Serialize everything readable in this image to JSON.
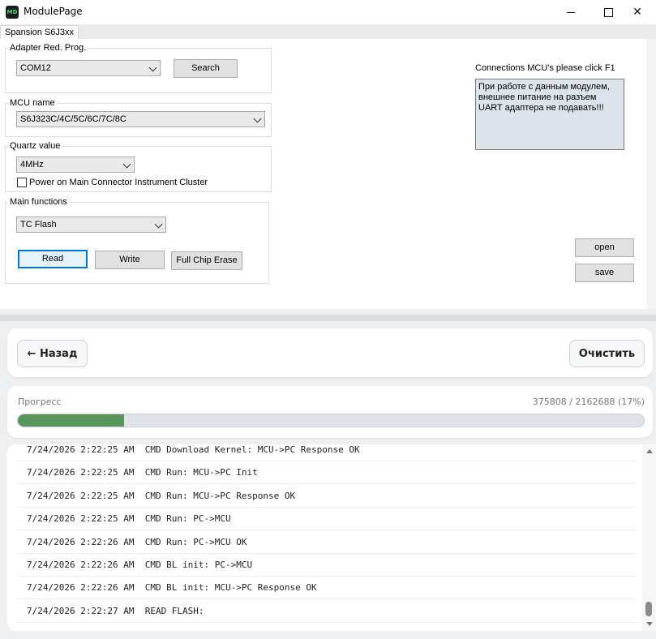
{
  "window": {
    "title": "ModulePage",
    "icon_text": "MD"
  },
  "tab": {
    "label": "Spansion S6J3xx"
  },
  "adapter": {
    "label": "Adapter Red. Prog.",
    "port": "COM12",
    "search_label": "Search"
  },
  "mcu": {
    "label": "MCU name",
    "value": "S6J323C/4C/5C/6C/7C/8C"
  },
  "quartz": {
    "label": "Quartz value",
    "value": "4MHz",
    "power_label": "Power on Main Connector Instrument Cluster",
    "power_checked": false
  },
  "functions": {
    "label": "Main functions",
    "value": "TC Flash",
    "read_label": "Read",
    "write_label": "Write",
    "erase_label": "Full Chip Erase"
  },
  "connections": {
    "label": "Connections MCU's please click F1",
    "note": "При работе с данным модулем, внешнее питание на разъем UART адаптера не подавать!!!"
  },
  "file": {
    "open_label": "open",
    "save_label": "save"
  },
  "toolbar": {
    "back_label": "← Назад",
    "clear_label": "Очистить"
  },
  "progress": {
    "label": "Прогресс",
    "done": 375808,
    "total": 2162688,
    "text": "375808 / 2162688 (17%)",
    "fraction": 0.17,
    "color": "#57955b"
  },
  "log": [
    "7/24/2026 2:22:25 AM  CMD Download Kernel: MCU->PC Response OK",
    "7/24/2026 2:22:25 AM  CMD Run: MCU->PC Init",
    "7/24/2026 2:22:25 AM  CMD Run: MCU->PC Response OK",
    "7/24/2026 2:22:25 AM  CMD Run: PC->MCU",
    "7/24/2026 2:22:26 AM  CMD Run: PC->MCU OK",
    "7/24/2026 2:22:26 AM  CMD BL init: PC->MCU",
    "7/24/2026 2:22:26 AM  CMD BL init: MCU->PC Response OK",
    "7/24/2026 2:22:27 AM  READ FLASH:"
  ]
}
